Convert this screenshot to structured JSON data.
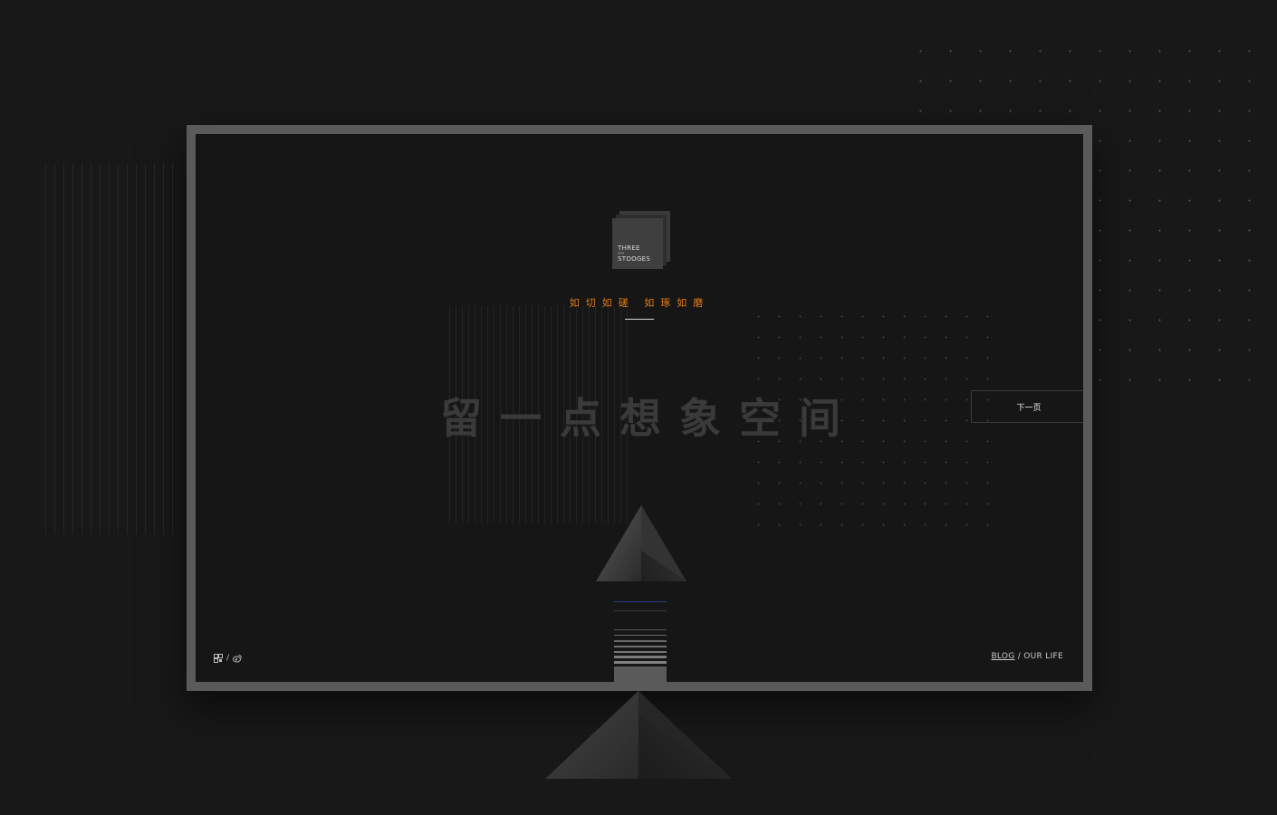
{
  "brand": {
    "logo_line1": "THREE",
    "logo_line2": "STOOGES"
  },
  "hero": {
    "motto": "如切如磋 如琢如磨",
    "headline": "留一点想象空间"
  },
  "nav": {
    "next_label": "下一页"
  },
  "footer": {
    "social_separator": "/",
    "blog_label": "BLOG",
    "blog_separator": "/",
    "our_life_label": "OUR LIFE"
  },
  "icons": [
    "qrcode-icon",
    "weibo-icon"
  ],
  "colors": {
    "background": "#181818",
    "monitor_frame": "#5a5a5a",
    "accent": "#e07a18",
    "headline": "#3a3a3a"
  }
}
